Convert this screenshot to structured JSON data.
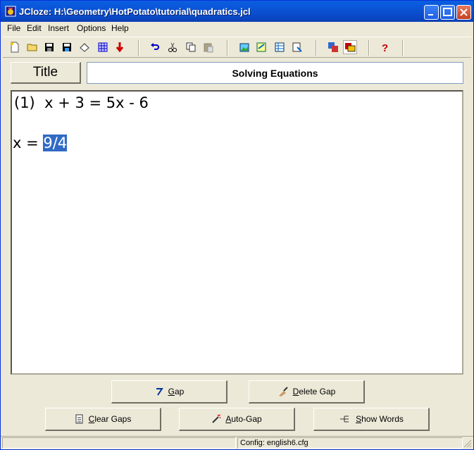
{
  "window": {
    "title": "JCloze: H:\\Geometry\\HotPotato\\tutorial\\quadratics.jcl"
  },
  "menu": [
    {
      "label": "File"
    },
    {
      "label": "Edit"
    },
    {
      "label": "Insert"
    },
    {
      "label": "Options"
    },
    {
      "label": "Help"
    }
  ],
  "toolbar_icons": [
    "new-file-icon",
    "open-folder-icon",
    "save-icon",
    "save-as-icon",
    "clear-icon",
    "web-page-icon",
    "export-arrow-icon",
    "undo-icon",
    "cut-icon",
    "copy-icon",
    "paste-icon",
    "add-picture-icon",
    "link-icon",
    "table-icon",
    "insert-icon",
    "colors-icon",
    "config-icon",
    "help-icon"
  ],
  "title_label": "Title",
  "title_value": "Solving Equations",
  "content": {
    "line1": "(1)  x + 3 = 5x - 6",
    "line2_prefix": "x = ",
    "line2_selected": "9/4"
  },
  "buttons": {
    "gap": "Gap",
    "delete_gap": "Delete Gap",
    "clear_gaps": "Clear Gaps",
    "auto_gap": "Auto-Gap",
    "show_words": "Show Words"
  },
  "status": {
    "config": "Config: english6.cfg"
  }
}
